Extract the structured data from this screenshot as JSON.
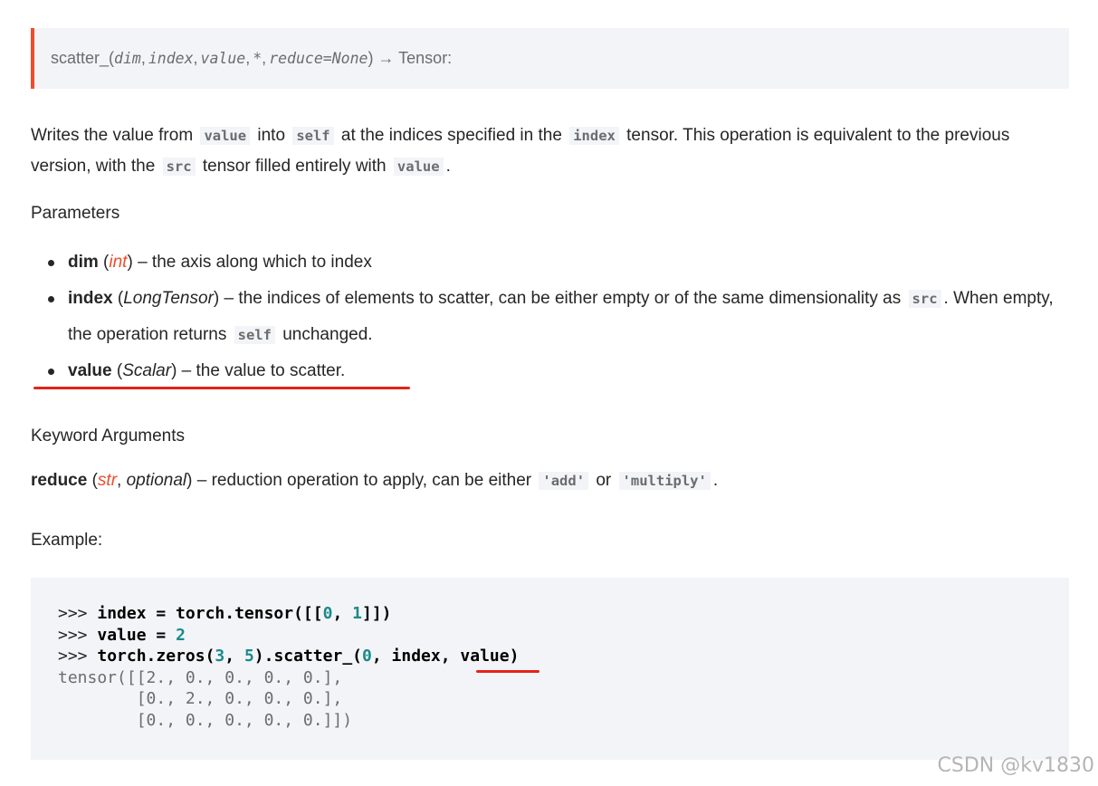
{
  "signature": {
    "func": "scatter_",
    "open_paren": "(",
    "arg1": "dim",
    "arg2": "index",
    "arg3": "value",
    "arg4": "*",
    "arg5": "reduce=None",
    "close_paren": ")",
    "returns": "→ Tensor:"
  },
  "description": {
    "t1": "Writes the value from",
    "c1": "value",
    "t2": "into",
    "c2": "self",
    "t3": "at the indices specified in the",
    "c3": "index",
    "t4": "tensor. This operation is equivalent to the previous version, with the",
    "c4": "src",
    "t5": "tensor filled entirely with",
    "c5": "value",
    "t6": "."
  },
  "parameters": {
    "heading": "Parameters",
    "items": [
      {
        "name": "dim",
        "type": "int",
        "desc": " – the axis along which to index"
      },
      {
        "name": "index",
        "type": "LongTensor",
        "desc": " – the indices of elements to scatter, can be either empty or of the same dimensionality as",
        "code1": "src",
        "desc2": ". When empty, the operation returns",
        "code2": "self",
        "desc3": "unchanged."
      },
      {
        "name": "value",
        "type": "Scalar",
        "desc": " – the value to scatter."
      }
    ]
  },
  "keyword_args": {
    "heading": "Keyword Arguments",
    "name": "reduce",
    "type1": "str",
    "type2": "optional",
    "desc": " – reduction operation to apply, can be either",
    "opt1": "'add'",
    "or": "or",
    "opt2": "'multiply'",
    "end": "."
  },
  "example": {
    "heading": "Example:",
    "prompt": ">>>",
    "l1a": "index = torch.tensor([[",
    "l1n1": "0",
    "l1b": ", ",
    "l1n2": "1",
    "l1c": "]])",
    "l2a": "value = ",
    "l2n": "2",
    "l3a": "torch.zeros(",
    "l3n1": "3",
    "l3b": ", ",
    "l3n2": "5",
    "l3c": ").scatter_(",
    "l3n3": "0",
    "l3d": ", index, ",
    "l3e": "value",
    "l3f": ")",
    "out1": "tensor([[2., 0., 0., 0., 0.],",
    "out2": "        [0., 2., 0., 0., 0.],",
    "out3": "        [0., 0., 0., 0., 0.]])"
  },
  "watermark": "CSDN @kv1830",
  "colors": {
    "accent": "#ee4c2c",
    "underline": "#e3241a",
    "code_bg": "#f3f4f7",
    "number": "#1a8a8a"
  }
}
